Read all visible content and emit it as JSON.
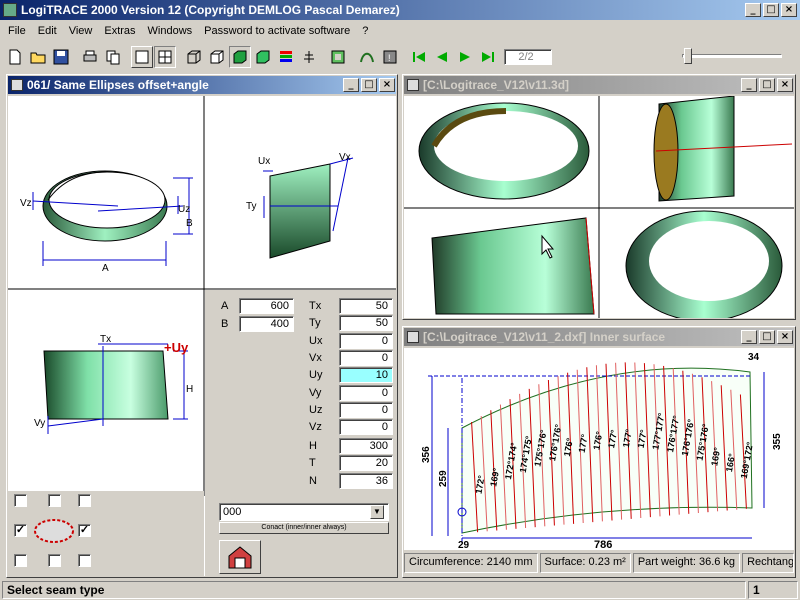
{
  "app": {
    "title": "LogiTRACE 2000  Version 12  (Copyright DEMLOG Pascal Demarez)",
    "menu": [
      "File",
      "Edit",
      "View",
      "Extras",
      "Windows",
      "Password to activate software",
      "?"
    ]
  },
  "toolbar": {
    "page_indicator": "2/2"
  },
  "left_window": {
    "title": "061/ Same Ellipses offset+angle",
    "view1_labels": {
      "a": "A",
      "b": "B",
      "vz": "Vz",
      "uz": "Uz"
    },
    "view2_labels": {
      "ux": "Ux",
      "vx": "Vx",
      "ty": "Ty"
    },
    "view3_labels": {
      "tx": "Tx",
      "uy": "+Uy",
      "h": "H",
      "vy": "Vy"
    },
    "params_ab": [
      {
        "label": "A",
        "value": "600"
      },
      {
        "label": "B",
        "value": "400"
      }
    ],
    "params": [
      {
        "label": "Tx",
        "value": "50"
      },
      {
        "label": "Ty",
        "value": "50"
      },
      {
        "label": "Ux",
        "value": "0"
      },
      {
        "label": "Vx",
        "value": "0"
      },
      {
        "label": "Uy",
        "value": "10"
      },
      {
        "label": "Vy",
        "value": "0"
      },
      {
        "label": "Uz",
        "value": "0"
      },
      {
        "label": "Vz",
        "value": "0"
      },
      {
        "label": "H",
        "value": "300"
      },
      {
        "label": "T",
        "value": "20"
      },
      {
        "label": "N",
        "value": "36"
      }
    ],
    "combo_value": "000",
    "combo_button": "Conact (inner/inner always)"
  },
  "view3d_window": {
    "title": "[C:\\Logitrace_V12\\v11.3d]"
  },
  "dxf_window": {
    "title": "[C:\\Logitrace_V12\\v11_2.dxf]  Inner surface",
    "dims": {
      "width": "786",
      "left_outer": "356",
      "left_inner": "259",
      "right": "355",
      "top_right": "34",
      "bottom_left": "29"
    },
    "angles": [
      "172°",
      "169°",
      "172°174°",
      "174°175°",
      "175°176°",
      "176°176°",
      "176°",
      "177°",
      "176°",
      "177°",
      "177°",
      "177°",
      "177°177°",
      "176°177°",
      "176°176°",
      "175°176°",
      "169°",
      "166°",
      "169°172°"
    ]
  },
  "status_strip": {
    "circumference": "Circumference: 2140 mm",
    "surface": "Surface: 0.23 m²",
    "weight": "Part weight: 36.6 kg",
    "shape": "Rechtang"
  },
  "statusbar": {
    "message": "Select seam type",
    "page": "1"
  },
  "colors": {
    "title_active": "#0a246a",
    "title_inactive": "#808080",
    "cylinder_green": "#7fe0a8",
    "highlight_field": "#99ffff",
    "dim_blue": "#0000cc",
    "red": "#cc0000"
  }
}
